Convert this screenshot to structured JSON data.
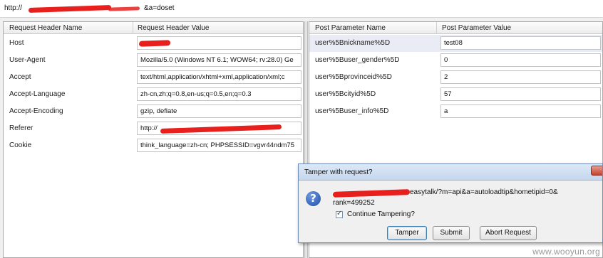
{
  "url": {
    "visible_start": "http://",
    "visible_end": "&a=doset"
  },
  "request_headers": {
    "col_name": "Request Header Name",
    "col_value": "Request Header Value",
    "rows": [
      {
        "name": "Host",
        "value": ""
      },
      {
        "name": "User-Agent",
        "value": "Mozilla/5.0 (Windows NT 6.1; WOW64; rv:28.0) Ge"
      },
      {
        "name": "Accept",
        "value": "text/html,application/xhtml+xml,application/xml;c"
      },
      {
        "name": "Accept-Language",
        "value": "zh-cn,zh;q=0.8,en-us;q=0.5,en;q=0.3"
      },
      {
        "name": "Accept-Encoding",
        "value": "gzip, deflate"
      },
      {
        "name": "Referer",
        "value": "http://"
      },
      {
        "name": "Cookie",
        "value": "think_language=zh-cn; PHPSESSID=vgvr44ndm75"
      }
    ]
  },
  "post_params": {
    "col_name": "Post Parameter Name",
    "col_value": "Post Parameter Value",
    "rows": [
      {
        "name": "user%5Bnickname%5D",
        "value": "test08"
      },
      {
        "name": "user%5Buser_gender%5D",
        "value": "0"
      },
      {
        "name": "user%5Bprovinceid%5D",
        "value": "2"
      },
      {
        "name": "user%5Bcityid%5D",
        "value": "57"
      },
      {
        "name": "user%5Buser_info%5D",
        "value": "a"
      }
    ]
  },
  "dialog": {
    "title": "Tamper with request?",
    "message_line1": "easytalk/?m=api&a=autoloadtip&hometipid=0&",
    "message_line2": "rank=499252",
    "checkbox_label": "Continue Tampering?",
    "checkbox_checked": true,
    "buttons": {
      "tamper": "Tamper",
      "submit": "Submit",
      "abort": "Abort Request"
    }
  },
  "watermark": "www.wooyun.org",
  "colors": {
    "redaction": "#e8201d",
    "selected_row": "#e9ecf4",
    "dialog_title": "#c5d7ee"
  }
}
